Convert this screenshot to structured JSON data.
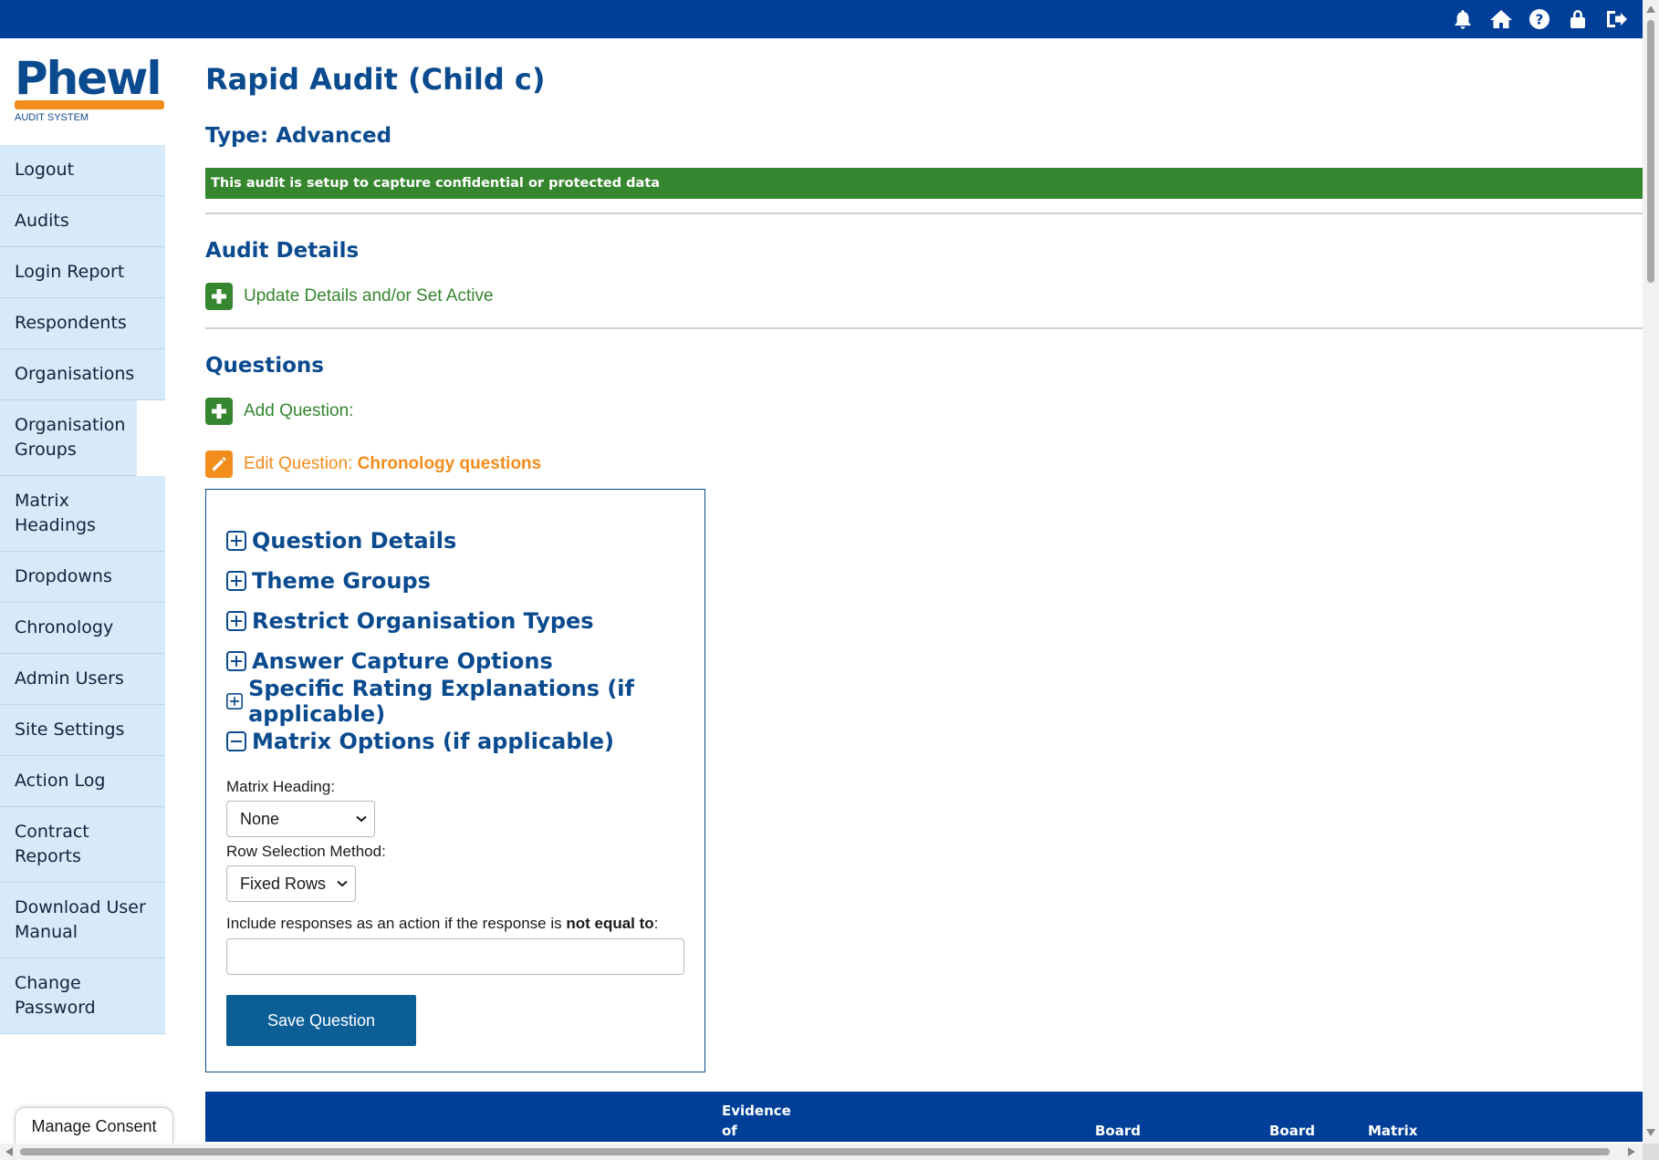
{
  "logo": {
    "wordmark": "Phewl",
    "subtitle": "AUDIT SYSTEM"
  },
  "topbar": {
    "icons": [
      "bell-icon",
      "home-icon",
      "help-icon",
      "lock-icon",
      "logout-icon"
    ]
  },
  "sidebar": {
    "items": [
      "Logout",
      "Audits",
      "Login Report",
      "Respondents",
      "Organisations",
      "Organisation Groups",
      "Matrix Headings",
      "Dropdowns",
      "Chronology",
      "Admin Users",
      "Site Settings",
      "Action Log",
      "Contract Reports",
      "Download User Manual",
      "Change Password"
    ]
  },
  "page": {
    "title": "Rapid Audit (Child c)",
    "type": "Type: Advanced",
    "notice": "This audit is setup to capture confidential or protected data"
  },
  "audit_details": {
    "heading": "Audit Details",
    "update_link": "Update Details and/or Set Active"
  },
  "questions": {
    "heading": "Questions",
    "add_label": "Add Question:",
    "edit_label": "Edit Question:",
    "edit_name": "Chronology questions",
    "sections": [
      {
        "label": "Question Details",
        "expanded": false
      },
      {
        "label": "Theme Groups",
        "expanded": false
      },
      {
        "label": "Restrict Organisation Types",
        "expanded": false
      },
      {
        "label": "Answer Capture Options",
        "expanded": false
      },
      {
        "label": "Specific Rating Explanations (if applicable)",
        "expanded": false
      },
      {
        "label": "Matrix Options (if applicable)",
        "expanded": true
      }
    ],
    "matrix_heading_label": "Matrix Heading:",
    "matrix_heading_value": "None",
    "row_selection_label": "Row Selection Method:",
    "row_selection_value": "Fixed Rows",
    "include_label_prefix": "Include responses as an action if the response is ",
    "include_label_bold": "not equal to",
    "include_label_suffix": ":",
    "include_value": "",
    "save_label": "Save Question"
  },
  "table_header": {
    "col_evidence_line1": "Evidence",
    "col_evidence_line2": "of",
    "col_board1": "Board",
    "col_board2": "Board",
    "col_matrix": "Matrix"
  },
  "consent": {
    "label": "Manage Consent"
  },
  "colors": {
    "navy": "#003f98",
    "heading_blue": "#0a4a8e",
    "green": "#36862f",
    "orange": "#f28c1b",
    "sidebar_bg": "#d6eaf9",
    "save_button": "#0c5e97"
  }
}
